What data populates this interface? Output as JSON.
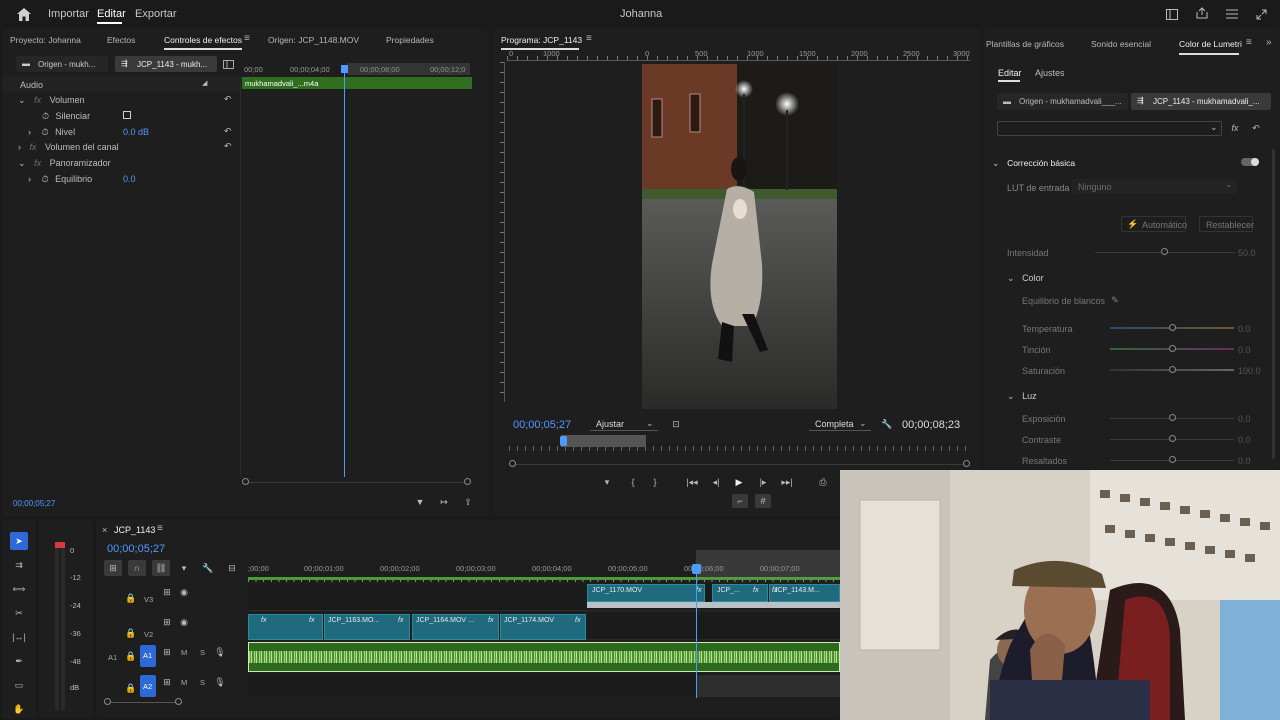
{
  "topbar": {
    "importar": "Importar",
    "editar": "Editar",
    "exportar": "Exportar",
    "project_name": "Johanna"
  },
  "left_panel": {
    "tabs": [
      "Proyecto: Johanna",
      "Efectos",
      "Controles de efectos",
      "Origen: JCP_1148.MOV",
      "Propiedades"
    ],
    "source_chip": "Origen - mukh...",
    "seq_chip": "JCP_1143 - mukh...",
    "ruler": [
      "00;00",
      "00;00;04;00",
      "00;00;08;00",
      "00;00;12;0"
    ],
    "clip_label": "mukhamadvali_...m4a",
    "section": "Audio",
    "rows": {
      "volumen": "Volumen",
      "silenciar": "Silenciar",
      "nivel": "Nivel",
      "nivel_val": "0.0 dB",
      "vol_canal": "Volumen del canal",
      "panoramizador": "Panoramizador",
      "equilibrio": "Equilibrio",
      "equilibrio_val": "0.0"
    },
    "timecode": "00;00;05;27"
  },
  "program": {
    "title": "Programa: JCP_1143",
    "ruler": [
      "0",
      "1000",
      "0",
      "500",
      "1000",
      "1500",
      "2000",
      "2500",
      "3000"
    ],
    "timecode": "00;00;05;27",
    "fit": "Ajustar",
    "quality": "Completa",
    "duration": "00;00;08;23"
  },
  "right_panel": {
    "tabs": [
      "Plantillas de gráficos",
      "Sonido esencial",
      "Color de Lumetri"
    ],
    "subtabs": [
      "Editar",
      "Ajustes"
    ],
    "source_chip": "Origen - mukhamadvali___...",
    "seq_chip": "JCP_1143 - mukhamadvali_...",
    "section": "Corrección básica",
    "lut_label": "LUT de entrada",
    "lut_value": "Ninguno",
    "auto": "Automático",
    "reset": "Restablecer",
    "intensity": "Intensidad",
    "intensity_val": "50.0",
    "color": "Color",
    "wb": "Equilibrio de blancos",
    "temp": "Temperatura",
    "temp_val": "0.0",
    "tint": "Tinción",
    "tint_val": "0.0",
    "sat": "Saturación",
    "sat_val": "100.0",
    "light": "Luz",
    "exposure": "Exposición",
    "exposure_val": "0.0",
    "contrast": "Contraste",
    "contrast_val": "0.0",
    "highlights": "Resaltados",
    "highlights_val": "0.0"
  },
  "timeline": {
    "seq_name": "JCP_1143",
    "timecode": "00;00;05;27",
    "ruler": [
      ";00;00",
      "00;00;01;00",
      "00;00;02;00",
      "00;00;03;00",
      "00;00;04;00",
      "00;00;05;00",
      "00;00;06;00",
      "00;00;07;00"
    ],
    "tracks": {
      "v3": "V3",
      "v2": "V2",
      "a1": "A1",
      "a2": "A2",
      "m": "M",
      "s": "S",
      "a1_src": "A1"
    },
    "clips": {
      "c1170": "JCP_1170.MOV",
      "c_short": "JCP_...",
      "c1143": "JCP_1143.M...",
      "c1163": "JCP_1163.MO...",
      "c1164": "JCP_1164.MOV ...",
      "c1174": "JCP_1174.MOV",
      "fx": "fx"
    },
    "meter": [
      "0",
      "-12",
      "-24",
      "-36",
      "-48",
      "dB"
    ]
  }
}
